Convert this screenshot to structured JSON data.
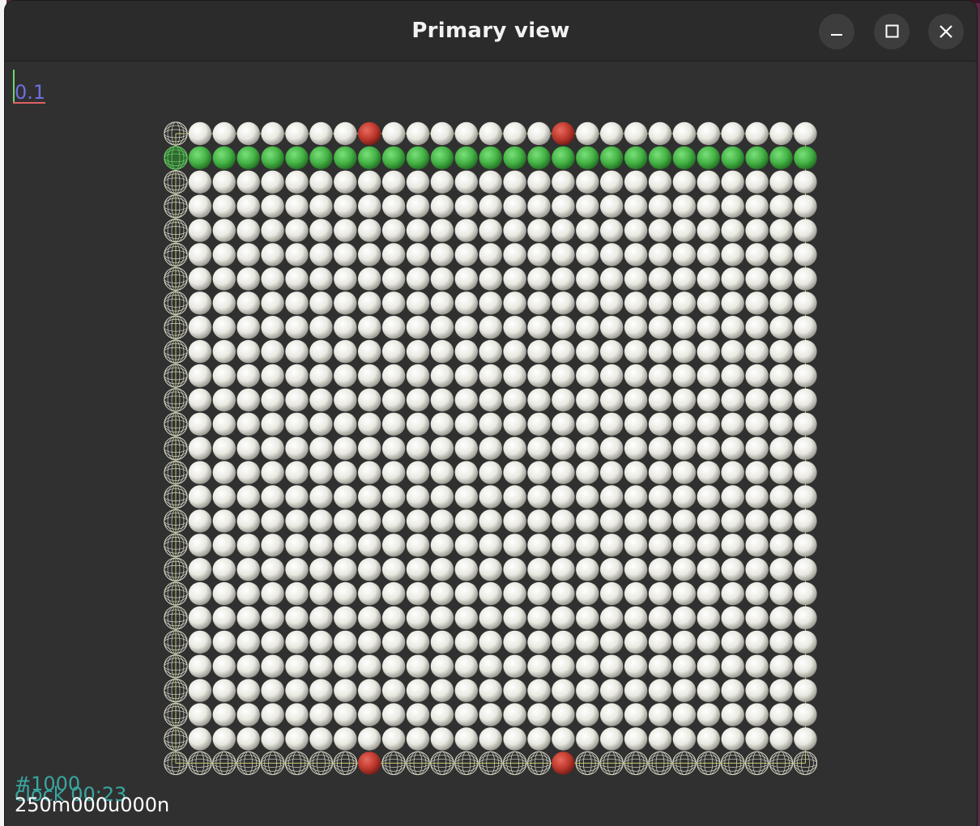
{
  "window": {
    "title": "Primary view",
    "controls": {
      "minimize_icon": "minimize-icon",
      "maximize_icon": "maximize-icon",
      "close_icon": "close-icon"
    }
  },
  "viewport": {
    "scale_label": "0.1",
    "hud": {
      "step": "#1000",
      "clock": "clock 00:23",
      "sim_time": "250m000u000n"
    }
  },
  "scene": {
    "columns": 27,
    "rows": 27,
    "solid_rows": [
      1,
      25
    ],
    "wireframe_rows": [
      26
    ],
    "wireframe_columns": [
      0
    ],
    "highlight_row": 1,
    "red_positions": [
      [
        0,
        8
      ],
      [
        0,
        16
      ],
      [
        26,
        8
      ],
      [
        26,
        16
      ]
    ],
    "colors": {
      "sphere_default": "#e8e8e0",
      "sphere_highlight": "#46b446",
      "sphere_red": "#c03a2e",
      "wireframe": "#d8d8c8",
      "background": "#303030"
    }
  }
}
